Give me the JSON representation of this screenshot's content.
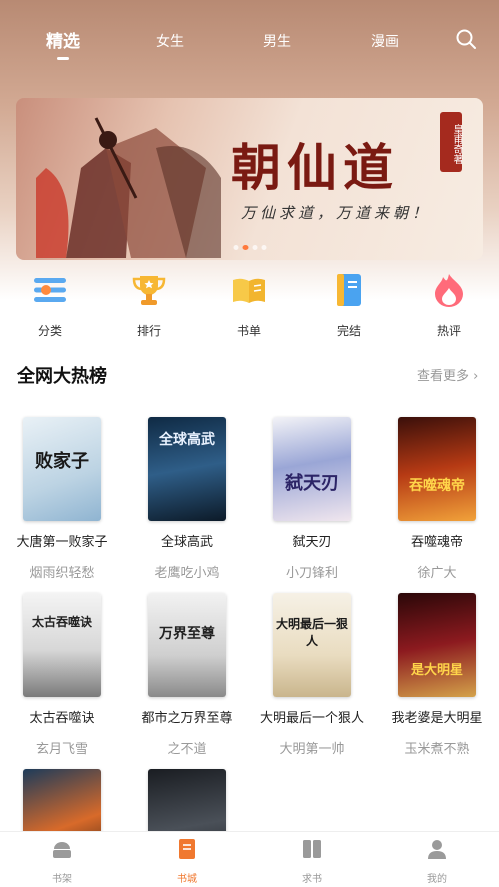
{
  "tabs": [
    {
      "label": "精选",
      "active": true
    },
    {
      "label": "女生",
      "active": false
    },
    {
      "label": "男生",
      "active": false
    },
    {
      "label": "漫画",
      "active": false
    }
  ],
  "banner": {
    "title": "朝仙道",
    "subtitle": "万仙求道，万道来朝！",
    "seal": "皇甫奇著"
  },
  "quick_nav": [
    {
      "label": "分类",
      "icon": "category-icon"
    },
    {
      "label": "排行",
      "icon": "trophy-icon"
    },
    {
      "label": "书单",
      "icon": "booklist-icon"
    },
    {
      "label": "完结",
      "icon": "finished-book-icon"
    },
    {
      "label": "热评",
      "icon": "flame-icon"
    }
  ],
  "section": {
    "title": "全网大热榜",
    "more": "查看更多 ›"
  },
  "books": [
    {
      "title": "大唐第一败家子",
      "author": "烟雨织轻愁",
      "cover_text": "败家子"
    },
    {
      "title": "全球高武",
      "author": "老鹰吃小鸡",
      "cover_text": "全球高武"
    },
    {
      "title": "弑天刃",
      "author": "小刀锋利",
      "cover_text": "弑天刃"
    },
    {
      "title": "吞噬魂帝",
      "author": "徐广大",
      "cover_text": "吞噬魂帝"
    },
    {
      "title": "太古吞噬诀",
      "author": "玄月飞雪",
      "cover_text": "太古吞噬诀"
    },
    {
      "title": "都市之万界至尊",
      "author": "之不道",
      "cover_text": "万界至尊"
    },
    {
      "title": "大明最后一个狠人",
      "author": "大明第一帅",
      "cover_text": "大明最后一狠人"
    },
    {
      "title": "我老婆是大明星",
      "author": "玉米煮不熟",
      "cover_text": "是大明星"
    }
  ],
  "bottom_nav": [
    {
      "label": "书架",
      "icon": "bookshelf-icon",
      "active": false
    },
    {
      "label": "书城",
      "icon": "bookstore-icon",
      "active": true
    },
    {
      "label": "求书",
      "icon": "request-book-icon",
      "active": false
    },
    {
      "label": "我的",
      "icon": "profile-icon",
      "active": false
    }
  ],
  "colors": {
    "accent": "#f0782f",
    "muted": "#999999"
  }
}
